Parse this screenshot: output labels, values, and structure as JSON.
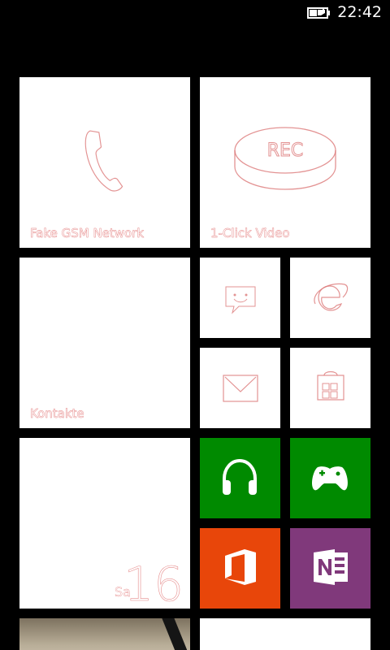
{
  "status_bar": {
    "time": "22:42",
    "battery_icon": "battery-charging-icon"
  },
  "tiles": {
    "phone": {
      "label": "Fake GSM Network",
      "icon": "phone-handset-icon"
    },
    "video": {
      "label": "1-Click Video",
      "icon": "record-button-icon",
      "icon_text": "REC"
    },
    "messaging": {
      "icon": "messaging-smiley-icon"
    },
    "ie": {
      "icon": "internet-explorer-icon"
    },
    "contacts": {
      "label": "Kontakte"
    },
    "mail": {
      "icon": "mail-envelope-icon"
    },
    "store": {
      "icon": "store-bag-icon"
    },
    "calendar": {
      "day": "Sa",
      "date": "16"
    },
    "music": {
      "icon": "headphones-icon",
      "color": "#008a00"
    },
    "games": {
      "icon": "xbox-controller-icon",
      "color": "#008a00"
    },
    "office": {
      "icon": "office-icon",
      "color": "#e8460a"
    },
    "onenote": {
      "icon": "onenote-icon",
      "color": "#80397b"
    },
    "photos": {
      "icon": "photo-thumbnail"
    }
  }
}
